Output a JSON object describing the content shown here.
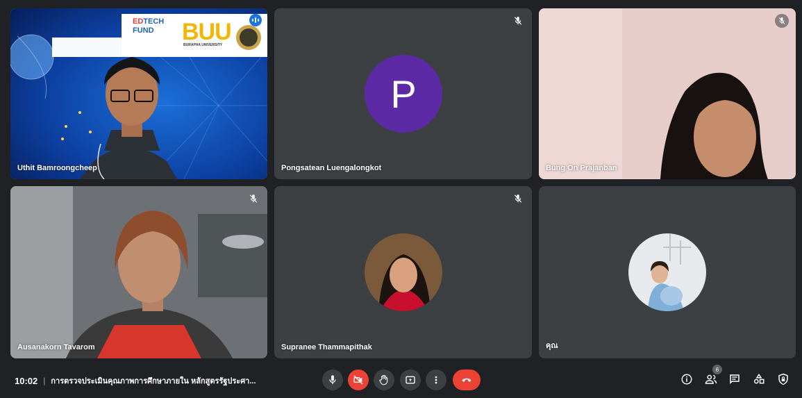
{
  "participants": [
    {
      "name": "Uthit Bamroongcheep"
    },
    {
      "name": "Pongsatean Luengalongkot",
      "initial": "P"
    },
    {
      "name": "Bung On Prajanban"
    },
    {
      "name": "Ausanakorn Tavarom"
    },
    {
      "name": "Supranee Thammapithak"
    },
    {
      "name": "คุณ"
    }
  ],
  "background": {
    "edtech_line1": "ED",
    "edtech_line2": "TECH",
    "edtech_line3": "FUND",
    "buu": "BUU",
    "buu_sub": "BURAPHA UNIVERSITY"
  },
  "bottom_bar": {
    "time": "10:02",
    "separator": "|",
    "meeting_title": "การตรวจประเมินคุณภาพการศึกษาภายใน หลักสูตรรัฐประศา...",
    "people_count": "6"
  },
  "colors": {
    "background": "#202124",
    "tile": "#3c4043",
    "end_call": "#ea4335",
    "avatar": "#5c2aa5",
    "speaking": "#8ab4f8"
  }
}
